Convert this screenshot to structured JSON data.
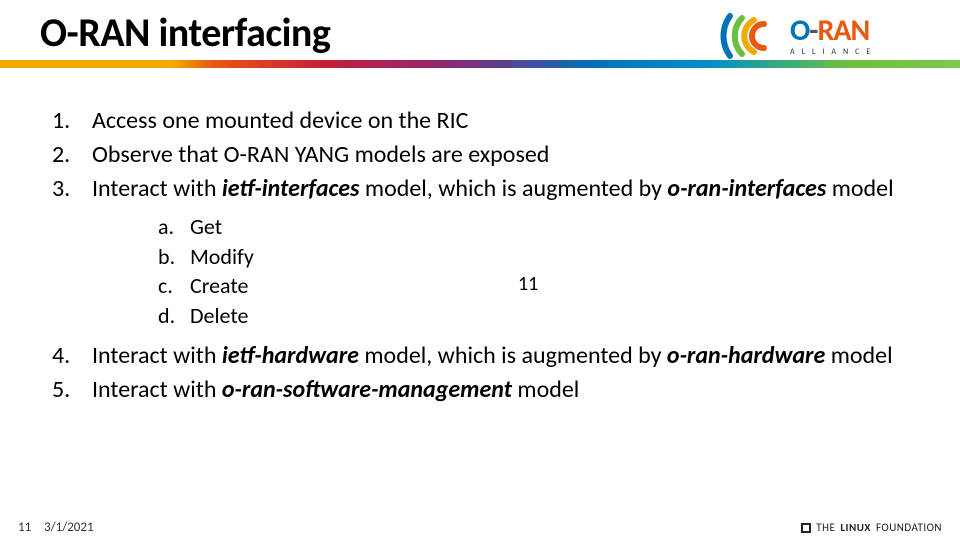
{
  "title": "O-RAN interfacing",
  "logo": {
    "o": "O",
    "dash": "-",
    "ran": "RAN",
    "sub": "ALLIANCE"
  },
  "items": {
    "i1": "Access one mounted device on the RIC",
    "i2": "Observe that O-RAN YANG models are exposed",
    "i3_a": "Interact with ",
    "i3_b": "ietf-interfaces",
    "i3_c": " model, which is augmented by ",
    "i3_d": "o-ran-interfaces",
    "i3_e": " model",
    "sub": {
      "a": "Get",
      "b": "Modify",
      "c": "Create",
      "d": "Delete"
    },
    "i4_a": "Interact with ",
    "i4_b": "ietf-hardware",
    "i4_c": " model, which is augmented by ",
    "i4_d": "o-ran-hardware",
    "i4_e": " model",
    "i5_a": "Interact with ",
    "i5_b": "o-ran-software-management",
    "i5_c": " model"
  },
  "float_number": "11",
  "footer": {
    "page": "11",
    "date": "3/1/2021",
    "lf_the": "THE",
    "lf_linux": "LINUX",
    "lf_foundation": "FOUNDATION"
  }
}
